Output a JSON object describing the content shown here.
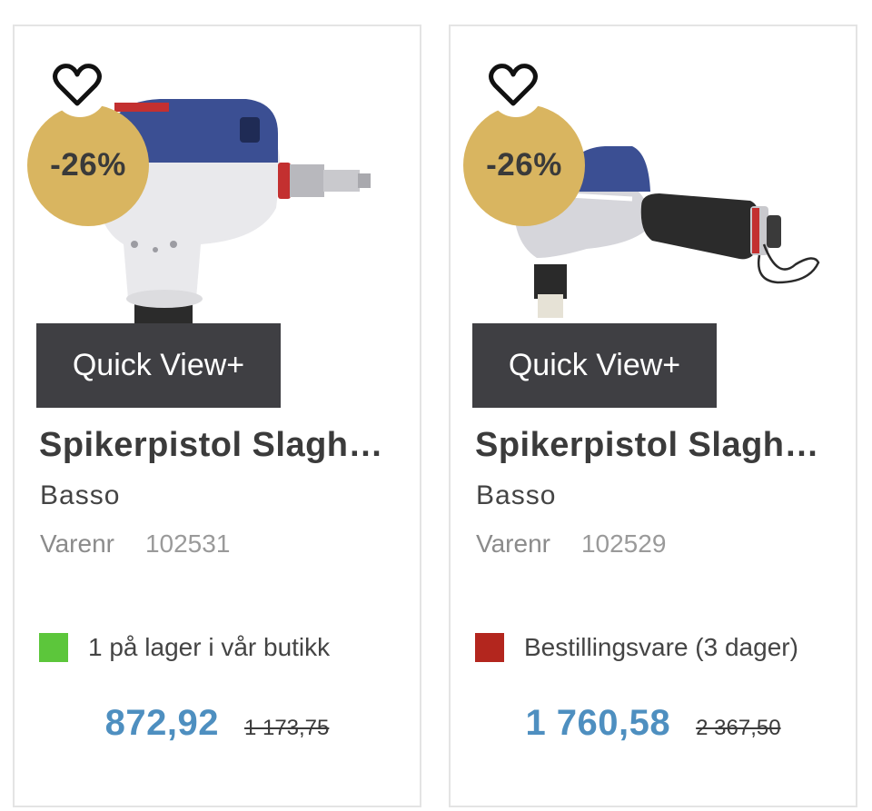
{
  "products": [
    {
      "discount": "-26%",
      "quick_view": "Quick View+",
      "title": "Spikerpistol Slaghammer",
      "brand": "Basso",
      "sku_label": "Varenr",
      "sku": "102531",
      "stock_text": "1 på lager i vår butikk",
      "stock_color": "#5cc63b",
      "price": "872,92",
      "old_price": "1 173,75",
      "wishlist_icon": "heart-outline-icon"
    },
    {
      "discount": "-26%",
      "quick_view": "Quick View+",
      "title": "Spikerpistol Slaghammer",
      "brand": "Basso",
      "sku_label": "Varenr",
      "sku": "102529",
      "stock_text": "Bestillingsvare (3 dager)",
      "stock_color": "#b3261e",
      "price": "1 760,58",
      "old_price": "2 367,50",
      "wishlist_icon": "heart-outline-icon"
    }
  ],
  "colors": {
    "badge": "#d9b560",
    "quick_view_bg": "#3f3f43",
    "price": "#4e8fc0"
  }
}
